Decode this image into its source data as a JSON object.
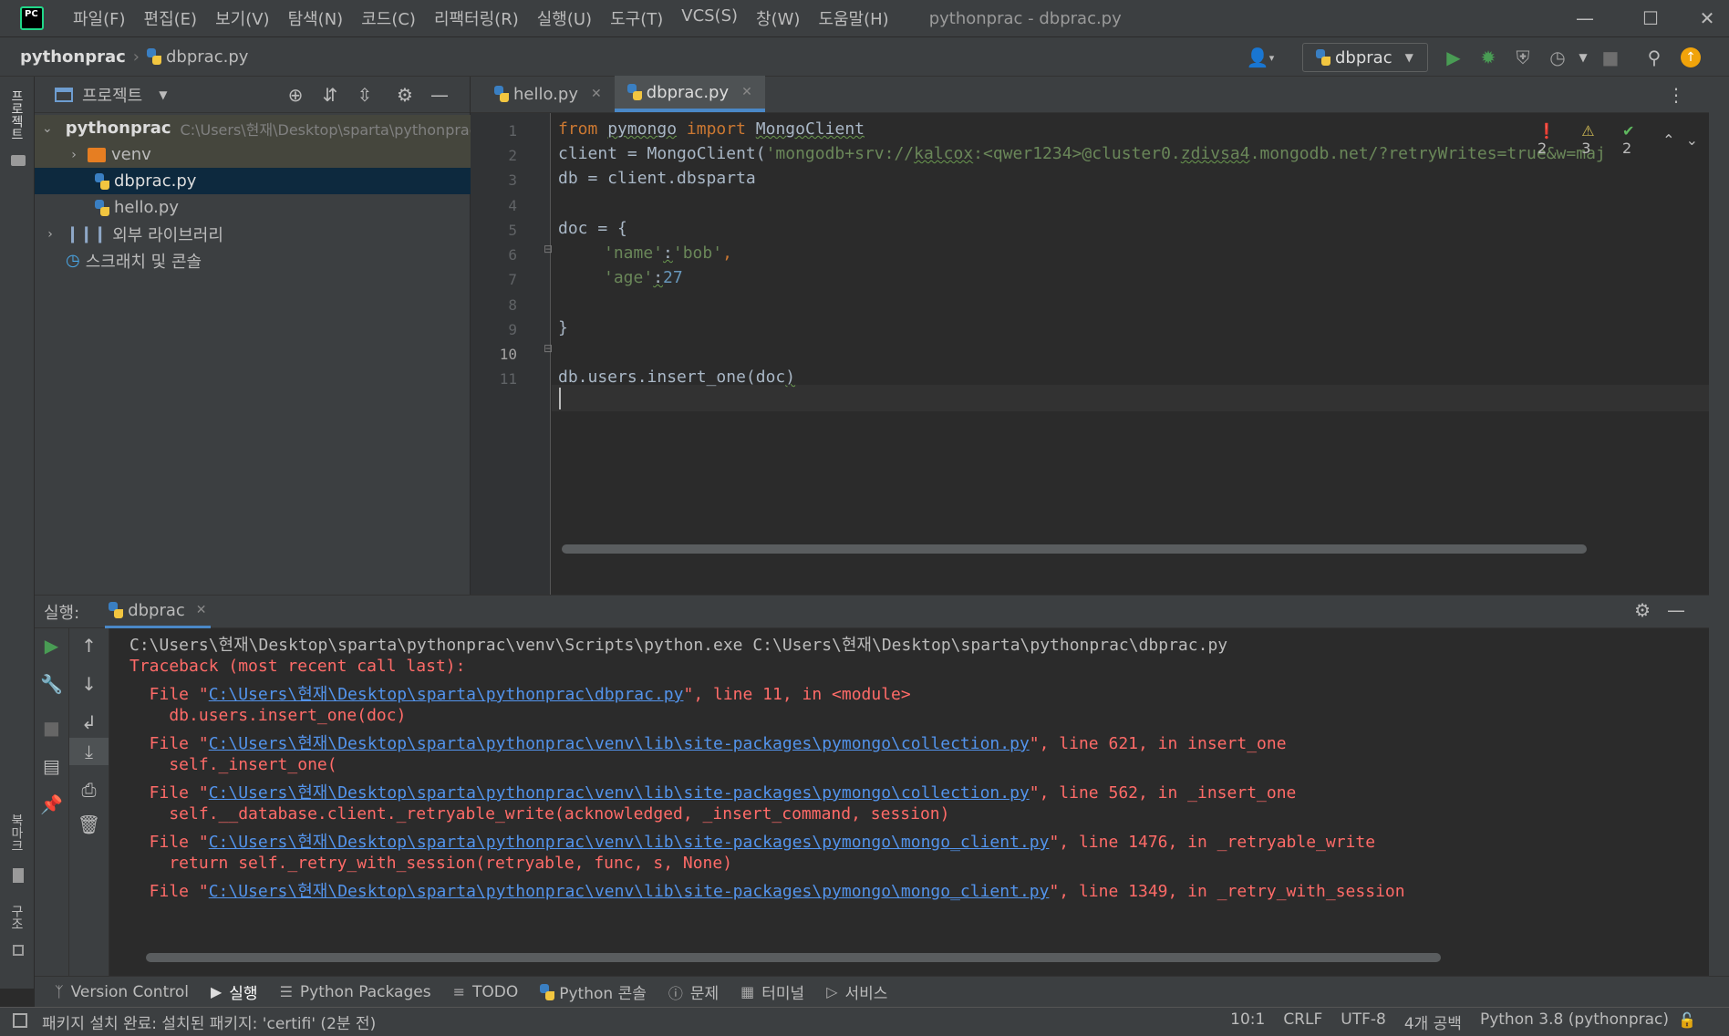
{
  "window": {
    "app_logo_text": "PC",
    "title": "pythonprac - dbprac.py"
  },
  "menu": [
    {
      "label": "파일(F)"
    },
    {
      "label": "편집(E)"
    },
    {
      "label": "보기(V)"
    },
    {
      "label": "탐색(N)"
    },
    {
      "label": "코드(C)"
    },
    {
      "label": "리팩터링(R)"
    },
    {
      "label": "실행(U)"
    },
    {
      "label": "도구(T)"
    },
    {
      "label": "VCS(S)"
    },
    {
      "label": "창(W)"
    },
    {
      "label": "도움말(H)"
    }
  ],
  "breadcrumb": {
    "project": "pythonprac",
    "file": "dbprac.py"
  },
  "run_config": {
    "name": "dbprac"
  },
  "colors": {
    "accent": "#4a88c7",
    "run_green": "#499c54",
    "error_red": "#ff6b68",
    "link_blue": "#5394ec",
    "update_orange": "#f0a30a"
  },
  "left_strip": {
    "project_tab": "프로젝트",
    "bookmarks_tab": "북마크",
    "structure_tab": "구조"
  },
  "project_panel": {
    "title": "프로젝트",
    "tree": [
      {
        "label": "pythonprac",
        "path": "C:\\Users\\현재\\Desktop\\sparta\\pythonprac"
      },
      {
        "label": "venv"
      },
      {
        "label": "dbprac.py"
      },
      {
        "label": "hello.py"
      },
      {
        "label": "외부 라이브러리"
      },
      {
        "label": "스크래치 및 콘솔"
      }
    ]
  },
  "editor": {
    "tabs": [
      {
        "label": "hello.py"
      },
      {
        "label": "dbprac.py"
      }
    ],
    "inspections": {
      "errors": "2",
      "warnings": "3",
      "ok": "2"
    },
    "line_numbers": [
      "1",
      "2",
      "3",
      "4",
      "5",
      "6",
      "7",
      "8",
      "9",
      "10",
      "11"
    ],
    "code": {
      "l1_from": "from",
      "l1_module": "pymongo",
      "l1_import": "import",
      "l1_name": "MongoClient",
      "l2_prefix": "client = MongoClient(",
      "l2_string_a": "'mongodb+srv://",
      "l2_user": "kalcox",
      "l2_string_b": ":<qwer1234>@cluster0.",
      "l2_host": "zdivsa4",
      "l2_string_c": ".mongodb.net/?retryWrites=true&w=maj",
      "l3": "db = client.dbsparta",
      "l5": "doc = {",
      "l6_key": "'name'",
      "l6_colon": ":",
      "l6_value": "'bob'",
      "l6_comma": ",",
      "l7_key": "'age'",
      "l7_colon": ":",
      "l7_value": "27",
      "l9": "}",
      "l11_a": "db.users.insert_one(doc",
      "l11_b": ")"
    }
  },
  "run_panel": {
    "label": "실행:",
    "tab": "dbprac",
    "console": {
      "cmd": "C:\\Users\\현재\\Desktop\\sparta\\pythonprac\\venv\\Scripts\\python.exe C:\\Users\\현재\\Desktop\\sparta\\pythonprac\\dbprac.py",
      "traceback": "Traceback (most recent call last):",
      "frames": [
        {
          "prefix": "  File \"",
          "link": "C:\\Users\\현재\\Desktop\\sparta\\pythonprac\\dbprac.py",
          "suffix": "\", line 11, in <module>",
          "code": "    db.users.insert_one(doc)"
        },
        {
          "prefix": "  File \"",
          "link": "C:\\Users\\현재\\Desktop\\sparta\\pythonprac\\venv\\lib\\site-packages\\pymongo\\collection.py",
          "suffix": "\", line 621, in insert_one",
          "code": "    self._insert_one("
        },
        {
          "prefix": "  File \"",
          "link": "C:\\Users\\현재\\Desktop\\sparta\\pythonprac\\venv\\lib\\site-packages\\pymongo\\collection.py",
          "suffix": "\", line 562, in _insert_one",
          "code": "    self.__database.client._retryable_write(acknowledged, _insert_command, session)"
        },
        {
          "prefix": "  File \"",
          "link": "C:\\Users\\현재\\Desktop\\sparta\\pythonprac\\venv\\lib\\site-packages\\pymongo\\mongo_client.py",
          "suffix": "\", line 1476, in _retryable_write",
          "code": "    return self._retry_with_session(retryable, func, s, None)"
        },
        {
          "prefix": "  File \"",
          "link": "C:\\Users\\현재\\Desktop\\sparta\\pythonprac\\venv\\lib\\site-packages\\pymongo\\mongo_client.py",
          "suffix": "\", line 1349, in _retry_with_session",
          "code": ""
        }
      ]
    }
  },
  "tool_tabs": [
    {
      "label": "Version Control",
      "icon": "branch-icon"
    },
    {
      "label": "실행",
      "icon": "play-icon"
    },
    {
      "label": "Python Packages",
      "icon": "layers-icon"
    },
    {
      "label": "TODO",
      "icon": "list-icon"
    },
    {
      "label": "Python 콘솔",
      "icon": "python-icon"
    },
    {
      "label": "문제",
      "icon": "info-icon"
    },
    {
      "label": "터미널",
      "icon": "terminal-icon"
    },
    {
      "label": "서비스",
      "icon": "services-icon"
    }
  ],
  "statusbar": {
    "message": "패키지 설치 완료: 설치된 패키지: 'certifi' (2분 전)",
    "position": "10:1",
    "line_sep": "CRLF",
    "encoding": "UTF-8",
    "indent": "4개 공백",
    "interpreter": "Python 3.8 (pythonprac)"
  }
}
